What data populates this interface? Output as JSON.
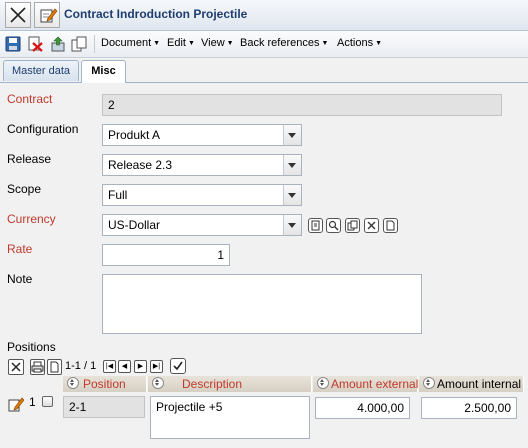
{
  "window": {
    "title": "Contract Indroduction Projectile"
  },
  "menu": {
    "items": [
      {
        "label": "Document"
      },
      {
        "label": "Edit"
      },
      {
        "label": "View"
      },
      {
        "label": "Back references"
      },
      {
        "label": "Actions"
      }
    ]
  },
  "tabs": [
    {
      "label": "Master data",
      "active": false
    },
    {
      "label": "Misc",
      "active": true
    }
  ],
  "form": {
    "contract": {
      "label": "Contract",
      "value": "2"
    },
    "configuration": {
      "label": "Configuration",
      "value": "Produkt A"
    },
    "release": {
      "label": "Release",
      "value": "Release 2.3"
    },
    "scope": {
      "label": "Scope",
      "value": "Full"
    },
    "currency": {
      "label": "Currency",
      "value": "US-Dollar"
    },
    "rate": {
      "label": "Rate",
      "value": "1"
    },
    "note": {
      "label": "Note",
      "value": ""
    }
  },
  "positions": {
    "label": "Positions",
    "pager": "1-1 / 1",
    "columns": {
      "position": "Position",
      "description": "Description",
      "amount_external": "Amount external",
      "amount_internal": "Amount internal"
    },
    "rows": [
      {
        "index": "1",
        "position": "2-1",
        "description": "Projectile +5",
        "amount_external": "4.000,00",
        "amount_internal": "2.500,00"
      }
    ]
  },
  "colors": {
    "required_label": "#c0392b",
    "title": "#1f3e70"
  }
}
